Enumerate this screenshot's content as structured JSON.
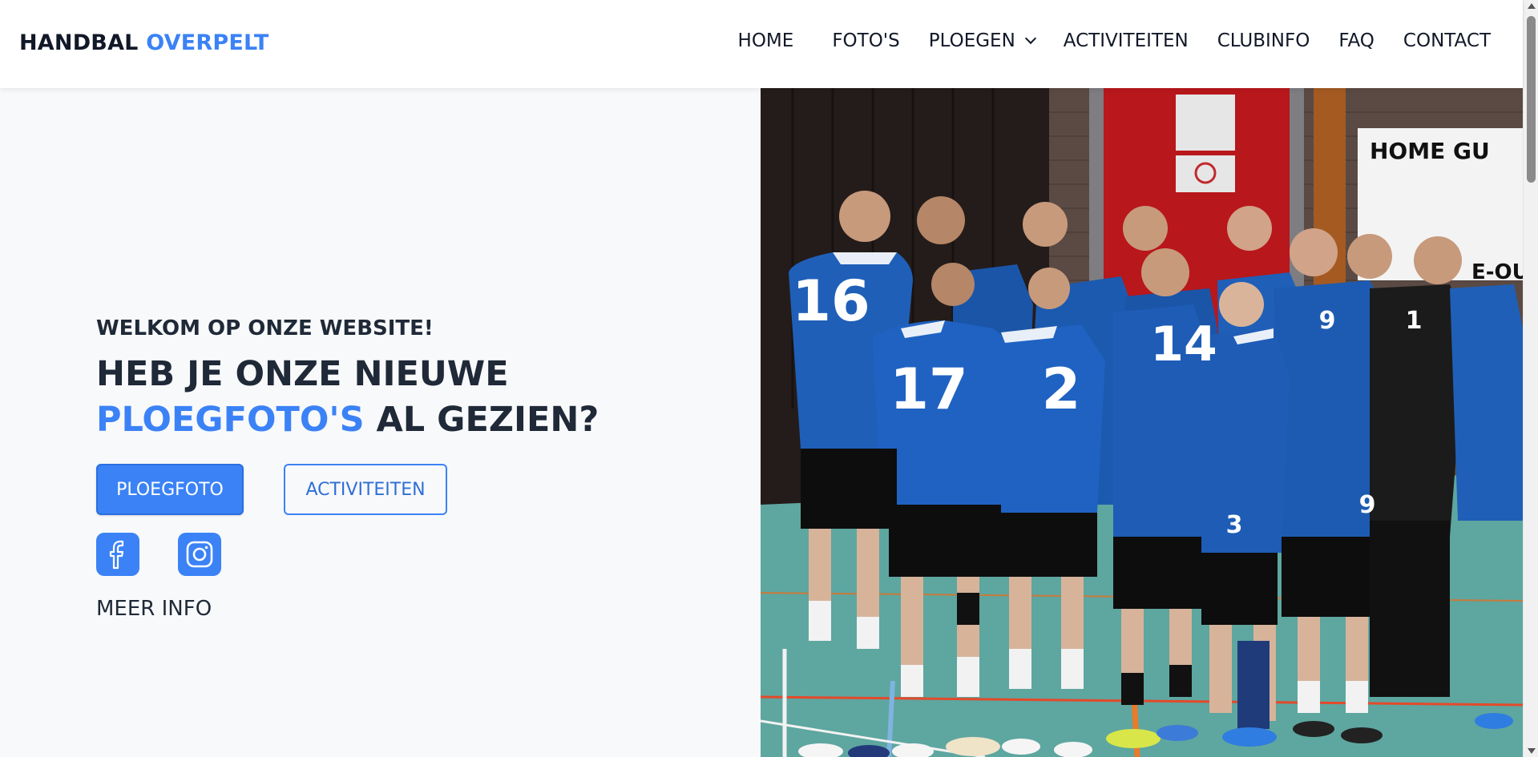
{
  "brand": {
    "name": "HANDBAL",
    "accent": "OVERPELT"
  },
  "nav": {
    "home": "HOME",
    "fotos": "FOTO'S",
    "ploegen": "PLOEGEN",
    "activiteiten": "ACTIVITEITEN",
    "clubinfo": "CLUBINFO",
    "faq": "FAQ",
    "contact": "CONTACT"
  },
  "hero": {
    "welcome": "WELKOM OP ONZE WEBSITE!",
    "headline_line1": "HEB JE ONZE NIEUWE",
    "headline_accent": "PLOEGFOTO'S",
    "headline_rest": " AL GEZIEN?",
    "primary_button": "PLOEGFOTO",
    "secondary_button": "ACTIVITEITEN",
    "more_info": "MEER INFO"
  },
  "photo": {
    "signs": {
      "top": "HOME GU",
      "side": "E-OU"
    },
    "jerseys": [
      "16",
      "17",
      "2",
      "14",
      "9",
      "1",
      "3",
      "9"
    ]
  },
  "icons": [
    "facebook-icon",
    "instagram-icon",
    "chevron-down-icon"
  ],
  "colors": {
    "accent": "#3b82f6",
    "text": "#1f2937",
    "background": "#f8f9fb"
  }
}
